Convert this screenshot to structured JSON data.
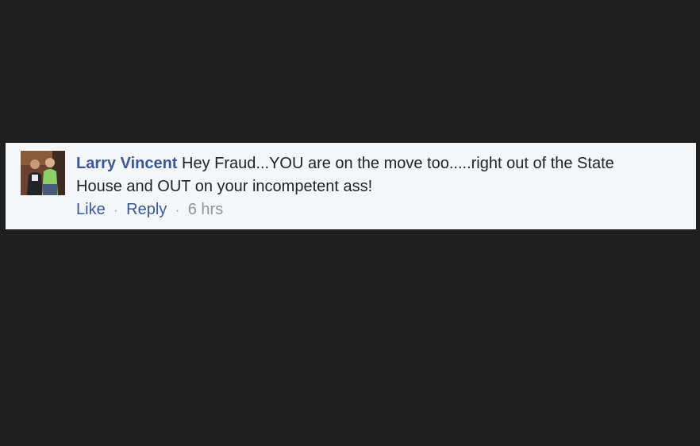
{
  "comment": {
    "author": "Larry Vincent",
    "text": "Hey Fraud...YOU are on the move too.....right out of the State House and OUT on your incompetent ass!",
    "actions": {
      "like_label": "Like",
      "separator": "·",
      "reply_label": "Reply",
      "timestamp": "6 hrs"
    }
  },
  "colors": {
    "page_background": "#1f1f1f",
    "comment_background": "#f5f6f8",
    "link": "#385898",
    "text": "#1d2129",
    "muted": "#90949c"
  }
}
